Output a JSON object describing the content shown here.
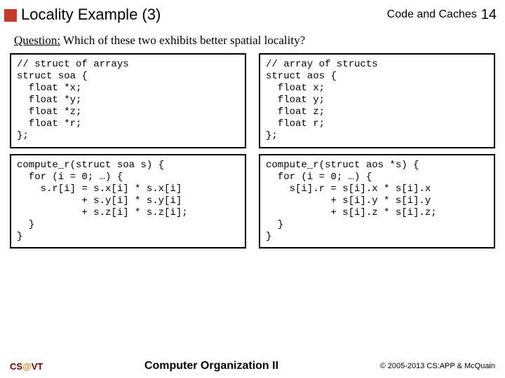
{
  "header": {
    "title": "Locality Example (3)",
    "section": "Code and Caches",
    "page": "14"
  },
  "question": {
    "label": "Question:",
    "text": " Which of these two exhibits better spatial locality?"
  },
  "code": {
    "top_left": "// struct of arrays\nstruct soa {\n  float *x;\n  float *y;\n  float *z;\n  float *r;\n};",
    "top_right": "// array of structs\nstruct aos {\n  float x;\n  float y;\n  float z;\n  float r;\n};",
    "bottom_left": "compute_r(struct soa s) {\n  for (i = 0; …) {\n    s.r[i] = s.x[i] * s.x[i]\n           + s.y[i] * s.y[i]\n           + s.z[i] * s.z[i];\n  }\n}",
    "bottom_right": "compute_r(struct aos *s) {\n  for (i = 0; …) {\n    s[i].r = s[i].x * s[i].x\n           + s[i].y * s[i].y\n           + s[i].z * s[i].z;\n  }\n}"
  },
  "footer": {
    "left_cs": "CS",
    "left_at": "@",
    "left_vt": "VT",
    "center": "Computer Organization II",
    "right": "© 2005-2013 CS:APP & McQuain"
  }
}
